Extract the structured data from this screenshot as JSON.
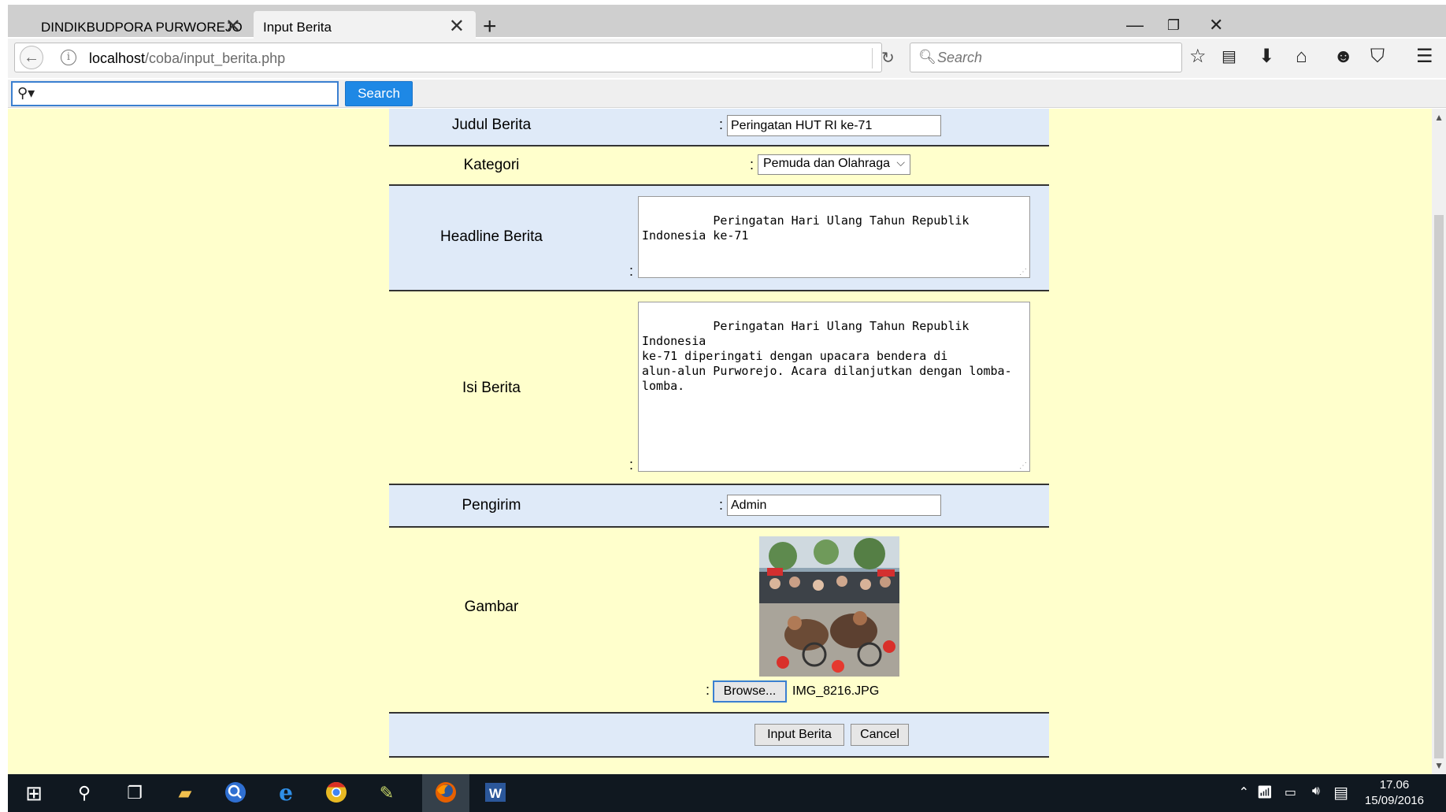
{
  "browser": {
    "tabs": [
      {
        "title": "DINDIKBUDPORA PURWOREJO",
        "active": false
      },
      {
        "title": "Input Berita",
        "active": true
      }
    ],
    "url_host": "localhost",
    "url_path": "/coba/input_berita.php",
    "search_placeholder": "Search"
  },
  "search_toolbar": {
    "button_label": "Search"
  },
  "form": {
    "judul": {
      "label": "Judul Berita",
      "value": "Peringatan HUT RI ke-71"
    },
    "kategori": {
      "label": "Kategori",
      "selected": "Pemuda dan Olahraga"
    },
    "headline": {
      "label": "Headline Berita",
      "value": "Peringatan Hari Ulang Tahun Republik Indonesia ke-71"
    },
    "isi": {
      "label": "Isi Berita",
      "value": "Peringatan Hari Ulang Tahun Republik Indonesia\nke-71 diperingati dengan upacara bendera di\nalun-alun Purworejo. Acara dilanjutkan dengan lomba-\nlomba."
    },
    "pengirim": {
      "label": "Pengirim",
      "value": "Admin"
    },
    "gambar": {
      "label": "Gambar",
      "browse_label": "Browse...",
      "file_name": "IMG_8216.JPG"
    },
    "submit_label": "Input Berita",
    "cancel_label": "Cancel",
    "colon": ":"
  },
  "taskbar": {
    "time": "17.06",
    "date": "15/09/2016"
  },
  "colors": {
    "page_background": "#ffffcc",
    "row_blue": "#dfeaf8",
    "toolbar_search_button": "#1e88e5",
    "taskbar": "#101820"
  },
  "icons": [
    "back-arrow-icon",
    "info-icon",
    "reload-icon",
    "search-icon",
    "bookmark-star-icon",
    "reading-list-icon",
    "download-icon",
    "home-icon",
    "chat-icon",
    "pocket-icon",
    "menu-icon",
    "windows-start-icon",
    "cortana-search-icon",
    "task-view-icon",
    "file-explorer-icon",
    "edge-icon",
    "chrome-icon",
    "firefox-icon",
    "word-icon"
  ]
}
